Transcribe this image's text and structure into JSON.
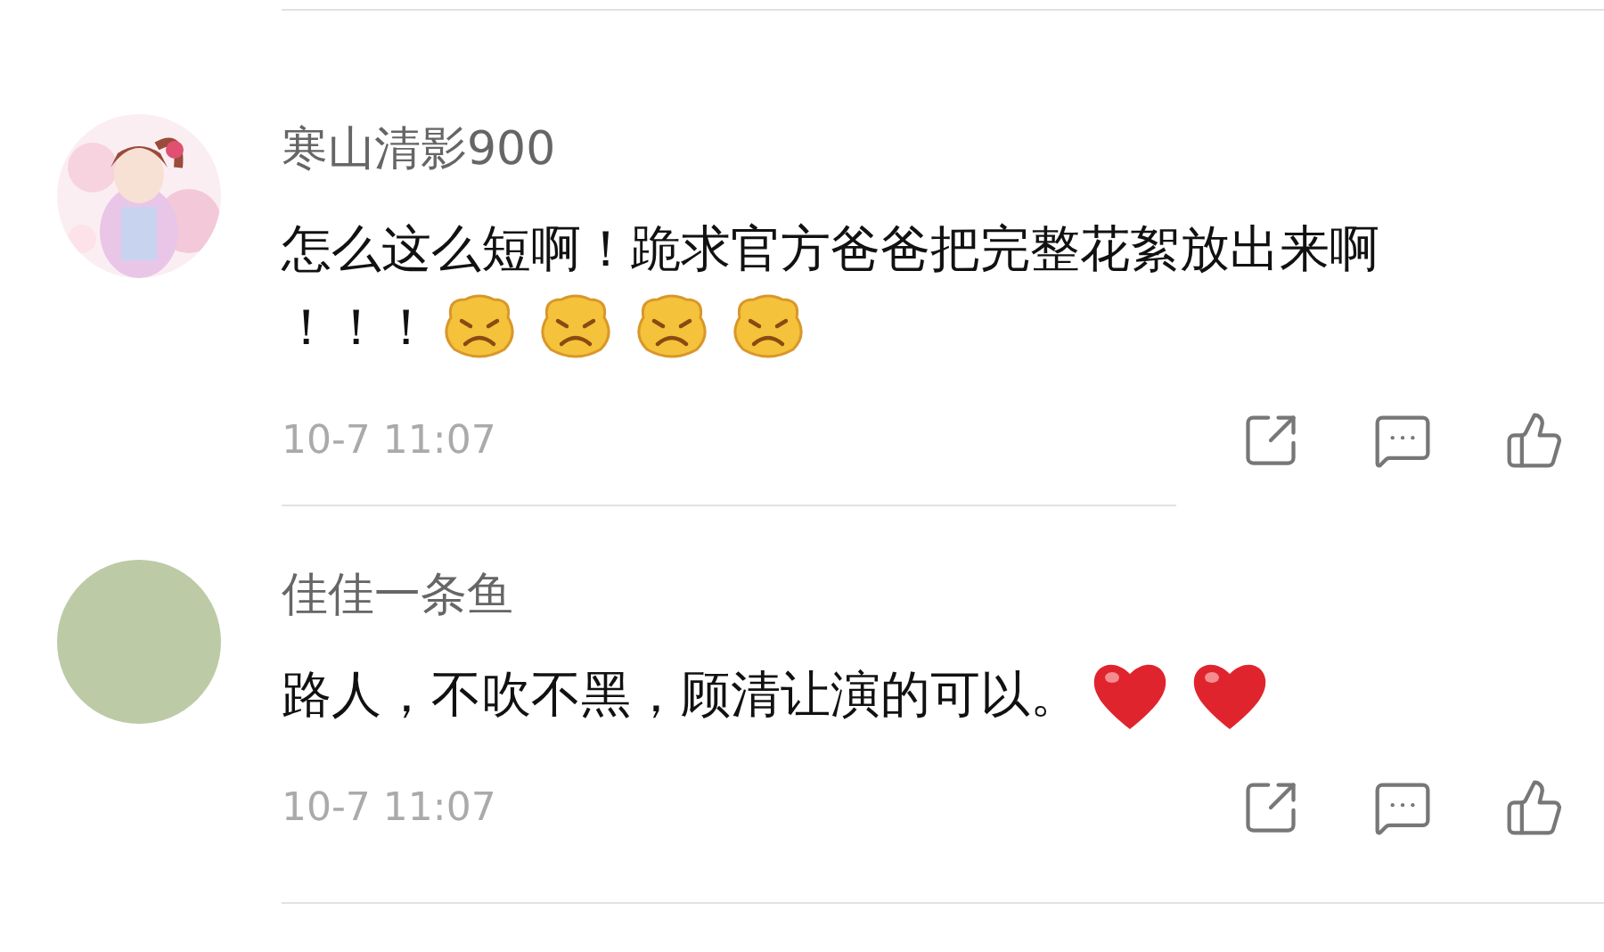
{
  "comments": [
    {
      "user": "寒山清影900",
      "lines": [
        "怎么这么短啊！跪求官方爸爸把完整花絮放出来啊",
        "！！！"
      ],
      "emojis": [
        {
          "kind": "sad"
        },
        {
          "kind": "sad"
        },
        {
          "kind": "sad"
        },
        {
          "kind": "sad"
        }
      ],
      "time": "10-7 11:07"
    },
    {
      "user": "佳佳一条鱼",
      "avatar": {
        "kind": "plain",
        "color": "#bccaa6"
      },
      "lines": [
        "路人，不吹不黑，顾清让演的可以。"
      ],
      "emojis": [
        {
          "kind": "heart"
        },
        {
          "kind": "heart"
        }
      ],
      "time": "10-7 11:07"
    }
  ]
}
